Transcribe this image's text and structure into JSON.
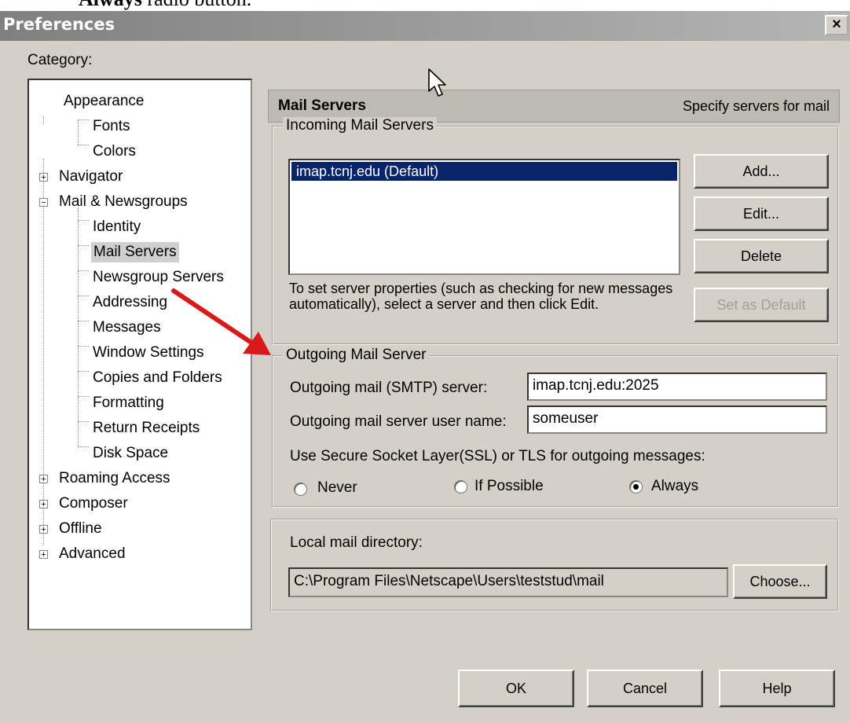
{
  "doc": {
    "bold": "Always",
    "rest": " radio button."
  },
  "window": {
    "title": "Preferences",
    "close": "×"
  },
  "category_label": "Category:",
  "tree": {
    "items": [
      {
        "label": "Appearance"
      },
      {
        "label": "Fonts"
      },
      {
        "label": "Colors"
      },
      {
        "label": "Navigator",
        "expander": "+"
      },
      {
        "label": "Mail & Newsgroups",
        "expander": "−"
      },
      {
        "label": "Identity"
      },
      {
        "label": "Mail Servers",
        "selected": true
      },
      {
        "label": "Newsgroup Servers"
      },
      {
        "label": "Addressing"
      },
      {
        "label": "Messages"
      },
      {
        "label": "Window Settings"
      },
      {
        "label": "Copies and Folders"
      },
      {
        "label": "Formatting"
      },
      {
        "label": "Return Receipts"
      },
      {
        "label": "Disk Space"
      },
      {
        "label": "Roaming Access",
        "expander": "+"
      },
      {
        "label": "Composer",
        "expander": "+"
      },
      {
        "label": "Offline",
        "expander": "+"
      },
      {
        "label": "Advanced",
        "expander": "+"
      }
    ]
  },
  "panel": {
    "title": "Mail Servers",
    "description": "Specify servers for mail",
    "incoming": {
      "legend": "Incoming Mail Servers",
      "servers": [
        "imap.tcnj.edu (Default)"
      ],
      "info": "To set server properties (such as checking for new messages automatically), select a server and then click Edit.",
      "buttons": {
        "add": "Add...",
        "edit": "Edit...",
        "delete": "Delete",
        "set_default": "Set as Default"
      }
    },
    "outgoing": {
      "legend": "Outgoing Mail Server",
      "smtp_label": "Outgoing mail (SMTP) server:",
      "smtp_value": "imap.tcnj.edu:2025",
      "user_label": "Outgoing mail server user name:",
      "user_value": "someuser",
      "ssl_label": "Use Secure Socket Layer(SSL) or TLS for outgoing messages:",
      "options": {
        "never": "Never",
        "if_possible": "If Possible",
        "always": "Always"
      },
      "selected": "Always"
    },
    "local": {
      "label": "Local mail directory:",
      "path": "C:\\Program Files\\Netscape\\Users\\teststud\\mail",
      "choose": "Choose..."
    }
  },
  "footer": {
    "ok": "OK",
    "cancel": "Cancel",
    "help": "Help"
  },
  "colors": {
    "accent": "#d91a1a",
    "selection": "#0a246a"
  }
}
